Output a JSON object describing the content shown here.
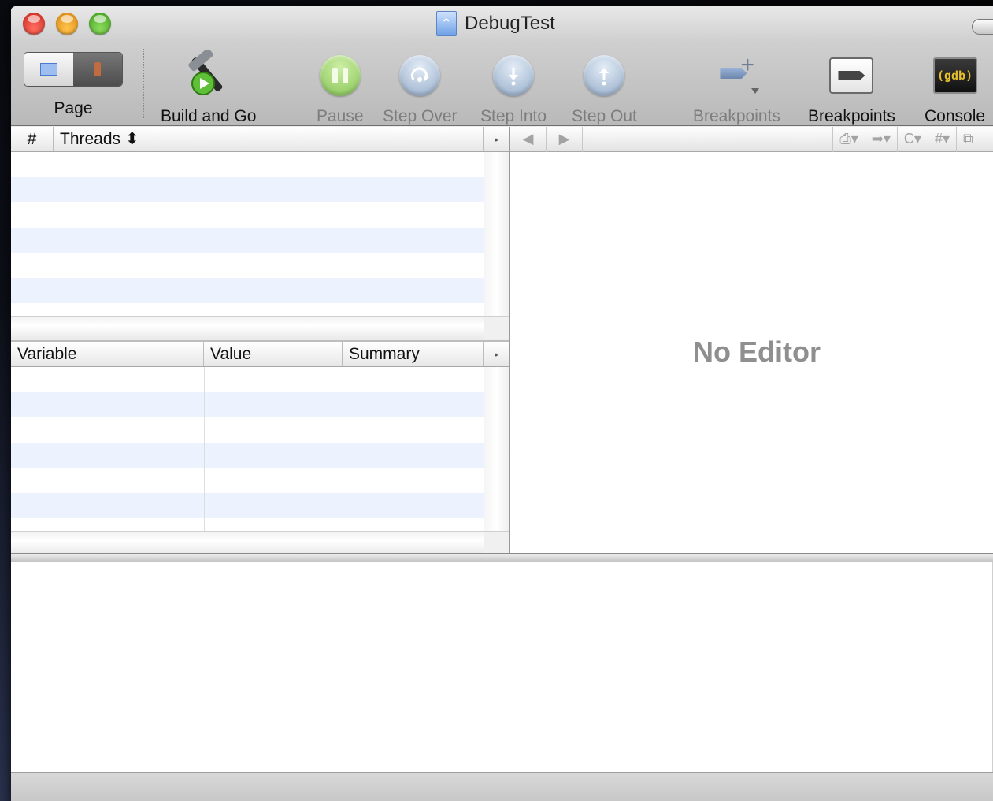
{
  "window": {
    "title": "DebugTest"
  },
  "toolbar": {
    "page_label": "Page",
    "build_go_label": "Build and Go",
    "pause_label": "Pause",
    "step_over_label": "Step Over",
    "step_into_label": "Step Into",
    "step_out_label": "Step Out",
    "add_breakpoint_label": "Breakpoints",
    "breakpoints_label": "Breakpoints",
    "console_label": "Console",
    "console_icon_text": "(gdb)"
  },
  "threads": {
    "col_number": "#",
    "col_threads": "Threads ⬍",
    "corner_button": "•"
  },
  "variables": {
    "col_variable": "Variable",
    "col_value": "Value",
    "col_summary": "Summary",
    "corner_button": "•"
  },
  "editor": {
    "back": "◀",
    "forward": "▶",
    "bookmarks_popup": "⎙▾",
    "breakpoints_popup": "➡▾",
    "class_popup": "C▾",
    "functions_popup": "#▾",
    "counterpart": "⧉",
    "empty_message": "No Editor"
  },
  "colors": {
    "row_stripe": "#edf3fe",
    "toolbar_bottom": "#b9b9b9"
  }
}
